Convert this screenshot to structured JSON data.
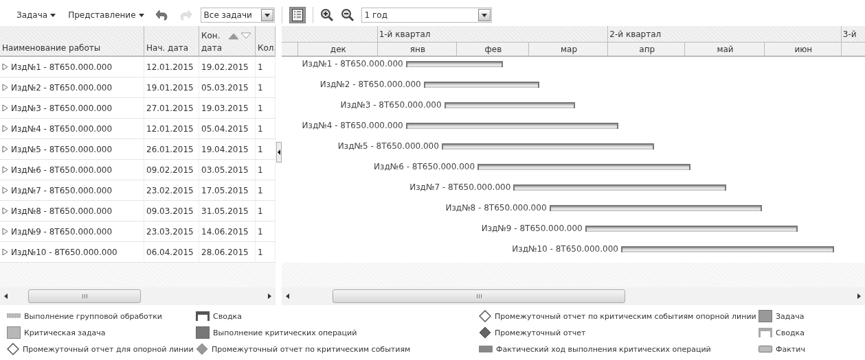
{
  "toolbar": {
    "menus": [
      {
        "label": "Задача"
      },
      {
        "label": "Представление"
      }
    ],
    "undo": {
      "disabled": false
    },
    "redo": {
      "disabled": true
    },
    "filter": {
      "value": "Все задачи"
    },
    "list_view": {
      "selected": true
    },
    "scale": {
      "value": "1 год"
    }
  },
  "table": {
    "columns": [
      {
        "label": "Наименование работы"
      },
      {
        "label": "Нач. дата"
      },
      {
        "label": "Кон. дата",
        "sorted_ascending": true
      },
      {
        "label": "Кол."
      }
    ],
    "rows": [
      {
        "name": "Изд№1 - 8Т650.000.000",
        "start": "12.01.2015",
        "end": "19.02.2015",
        "qty": "1",
        "bar_label": "Изд№1 - 8Т650.000.000"
      },
      {
        "name": "Изд№2 - 8Т650.000.000",
        "start": "19.01.2015",
        "end": "05.03.2015",
        "qty": "1",
        "bar_label": "Изд№2 - 8Т650.000.000"
      },
      {
        "name": "Изд№3 - 8Т650.000.000",
        "start": "27.01.2015",
        "end": "19.03.2015",
        "qty": "1",
        "bar_label": "Изд№3 - 8Т650.000.000"
      },
      {
        "name": "Изд№4 - 8Т650.000.000",
        "start": "12.01.2015",
        "end": "05.04.2015",
        "qty": "1",
        "bar_label": "Изд№4 - 8Т650.000.000"
      },
      {
        "name": "Изд№5 - 8Т650.000.000",
        "start": "26.01.2015",
        "end": "19.04.2015",
        "qty": "1",
        "bar_label": "Изд№5 - 8Т650.000.000"
      },
      {
        "name": "Изд№6 - 8Т650.000.000",
        "start": "09.02.2015",
        "end": "03.05.2015",
        "qty": "1",
        "bar_label": "Изд№6 - 8Т650.000.000"
      },
      {
        "name": "Изд№7 - 8Т650.000.000",
        "start": "23.02.2015",
        "end": "17.05.2015",
        "qty": "1",
        "bar_label": "Изд№7 - 8Т650.000.000"
      },
      {
        "name": "Изд№8 - 8Т650.000.000",
        "start": "09.03.2015",
        "end": "31.05.2015",
        "qty": "1",
        "bar_label": "Изд№8 - 8Т650.000.000"
      },
      {
        "name": "Изд№9 - 8Т650.000.000",
        "start": "23.03.2015",
        "end": "14.06.2015",
        "qty": "1",
        "bar_label": "Изд№9 - 8Т650.000.000"
      },
      {
        "name": "Изд№10 - 8Т650.000.000",
        "start": "06.04.2015",
        "end": "28.06.2015",
        "qty": "1",
        "bar_label": "Изд№10 - 8Т650.000.000"
      }
    ]
  },
  "timeline": {
    "quarters": [
      {
        "label": "1-й квартал"
      },
      {
        "label": "2-й квартал"
      },
      {
        "label": "3-й"
      }
    ],
    "months": [
      {
        "label": "дек"
      },
      {
        "label": "янв"
      },
      {
        "label": "фев"
      },
      {
        "label": "мар"
      },
      {
        "label": "апр"
      },
      {
        "label": "май"
      },
      {
        "label": "июн"
      }
    ]
  },
  "legend": {
    "columns": [
      [
        {
          "kind": "dashed-bar",
          "label": "Выполнение групповой обработки"
        },
        {
          "kind": "box-light",
          "label": "Критическая задача"
        },
        {
          "kind": "diamond-hollow",
          "label": "Промежуточный отчет для опорной линии"
        }
      ],
      [
        {
          "kind": "summary-dark",
          "label": "Сводка"
        },
        {
          "kind": "box-dark",
          "label": "Выполнение критических операций"
        },
        {
          "kind": "diamond-grey",
          "label": "Промежуточный отчет по критическим событиям"
        }
      ],
      [
        {
          "kind": "diamond-hollow",
          "label": "Промежуточный отчет по критическим событиям опорной линии"
        },
        {
          "kind": "diamond-dark",
          "label": "Промежуточный отчет"
        },
        {
          "kind": "bar-dark",
          "label": "Фактический ход выполнения критических операций"
        }
      ],
      [
        {
          "kind": "box-mid",
          "label": "Задача"
        },
        {
          "kind": "summary-light",
          "label": "Сводка"
        },
        {
          "kind": "bar-light",
          "label": "Фактич"
        }
      ]
    ]
  }
}
